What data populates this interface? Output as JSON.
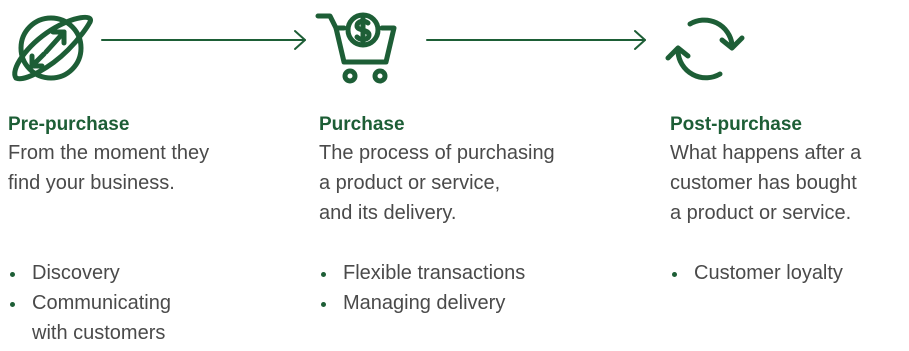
{
  "colors": {
    "accent": "#1d5e36",
    "text": "#4a4a4a"
  },
  "icons": {
    "pre_purchase": "globe-arrows-icon",
    "purchase": "shopping-cart-dollar-icon",
    "post_purchase": "refresh-cycle-icon",
    "connector": "arrow-right-icon"
  },
  "stages": [
    {
      "title": "Pre-purchase",
      "description_lines": [
        "From the moment they",
        "find your business."
      ],
      "bullets": [
        {
          "lines": [
            "Discovery"
          ]
        },
        {
          "lines": [
            "Communicating",
            "with customers"
          ]
        }
      ]
    },
    {
      "title": "Purchase",
      "description_lines": [
        "The process of purchasing",
        "a product or service,",
        "and its delivery."
      ],
      "bullets": [
        {
          "lines": [
            "Flexible transactions"
          ]
        },
        {
          "lines": [
            "Managing delivery"
          ]
        }
      ]
    },
    {
      "title": "Post-purchase",
      "description_lines": [
        "What happens after a",
        "customer has bought",
        "a product or service."
      ],
      "bullets": [
        {
          "lines": [
            "Customer loyalty"
          ]
        }
      ]
    }
  ]
}
